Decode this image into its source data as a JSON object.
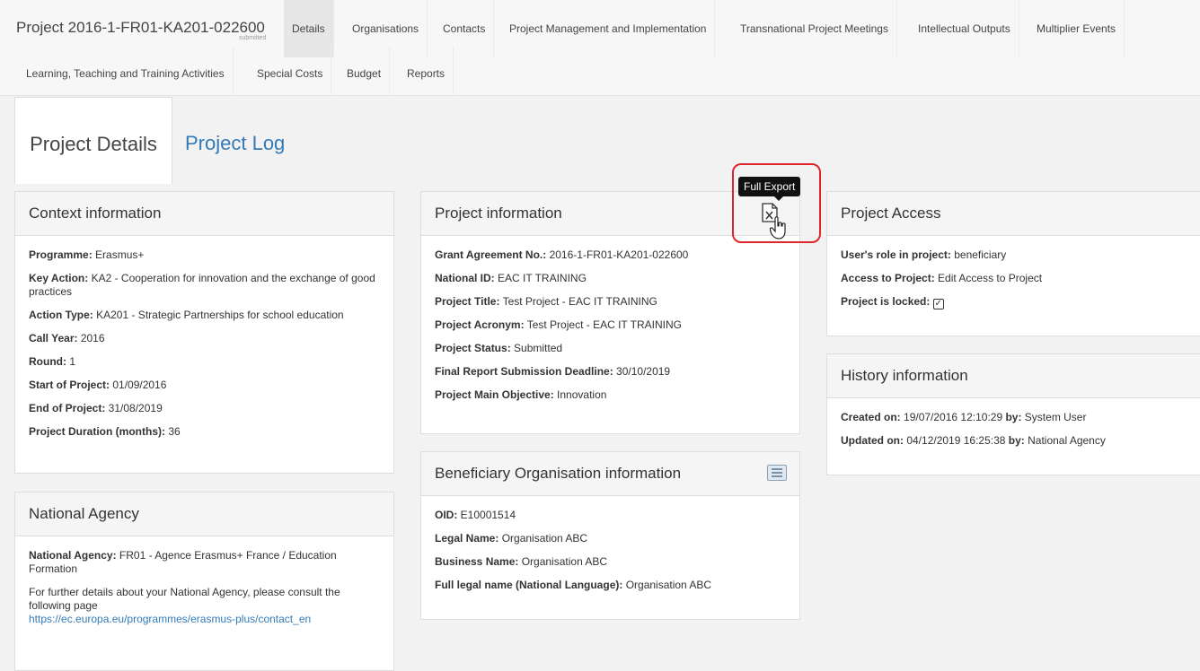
{
  "header": {
    "project_title": "Project 2016-1-FR01-KA201-022600",
    "status": "submitted"
  },
  "nav": {
    "row1": [
      "Details",
      "Organisations",
      "Contacts",
      "Project Management and Implementation",
      "Transnational Project Meetings",
      "Intellectual Outputs",
      "Multiplier Events"
    ],
    "row2": [
      "Learning, Teaching and Training Activities",
      "Special Costs",
      "Budget",
      "Reports"
    ]
  },
  "page_tabs": {
    "details": "Project Details",
    "log": "Project Log"
  },
  "context": {
    "title": "Context information",
    "programme_label": "Programme:",
    "programme": " Erasmus+",
    "key_action_label": "Key Action:",
    "key_action": " KA2 - Cooperation for innovation and the exchange of good practices",
    "action_type_label": "Action Type:",
    "action_type": " KA201 - Strategic Partnerships for school education",
    "call_year_label": "Call Year:",
    "call_year": " 2016",
    "round_label": "Round:",
    "round": " 1",
    "start_label": "Start of Project:",
    "start": " 01/09/2016",
    "end_label": "End of Project:",
    "end": " 31/08/2019",
    "duration_label": "Project Duration (months):",
    "duration": " 36"
  },
  "national_agency": {
    "title": "National Agency",
    "label": "National Agency:",
    "value": " FR01 - Agence Erasmus+ France / Education Formation",
    "note": "For further details about your National Agency, please consult the following page",
    "link": "https://ec.europa.eu/programmes/erasmus-plus/contact_en"
  },
  "project_info": {
    "title": "Project information",
    "tooltip": "Full Export",
    "grant_label": "Grant Agreement No.:",
    "grant": " 2016-1-FR01-KA201-022600",
    "national_id_label": "National ID:",
    "national_id": " EAC IT TRAINING",
    "proj_title_label": "Project Title:",
    "proj_title": " Test Project - EAC IT TRAINING",
    "acronym_label": "Project Acronym:",
    "acronym": " Test Project - EAC IT TRAINING",
    "status_label": "Project Status:",
    "status": " Submitted",
    "deadline_label": "Final Report Submission Deadline:",
    "deadline": " 30/10/2019",
    "objective_label": "Project Main Objective:",
    "objective": " Innovation"
  },
  "beneficiary": {
    "title": "Beneficiary Organisation information",
    "oid_label": "OID:",
    "oid": " E10001514",
    "legal_label": "Legal Name:",
    "legal": " Organisation ABC",
    "business_label": "Business Name:",
    "business": " Organisation ABC",
    "full_label": "Full legal name (National Language):",
    "full": " Organisation ABC"
  },
  "access": {
    "title": "Project Access",
    "role_label": "User's role in project:",
    "role": " beneficiary",
    "access_label": "Access to Project:",
    "access": " Edit Access to Project",
    "locked_label": "Project is locked:"
  },
  "history": {
    "title": "History information",
    "created_label": "Created on:",
    "created": " 19/07/2016 12:10:29 ",
    "created_by_label": "by:",
    "created_by": " System User",
    "updated_label": "Updated on:",
    "updated": " 04/12/2019 16:25:38 ",
    "updated_by_label": "by:",
    "updated_by": " National Agency"
  }
}
